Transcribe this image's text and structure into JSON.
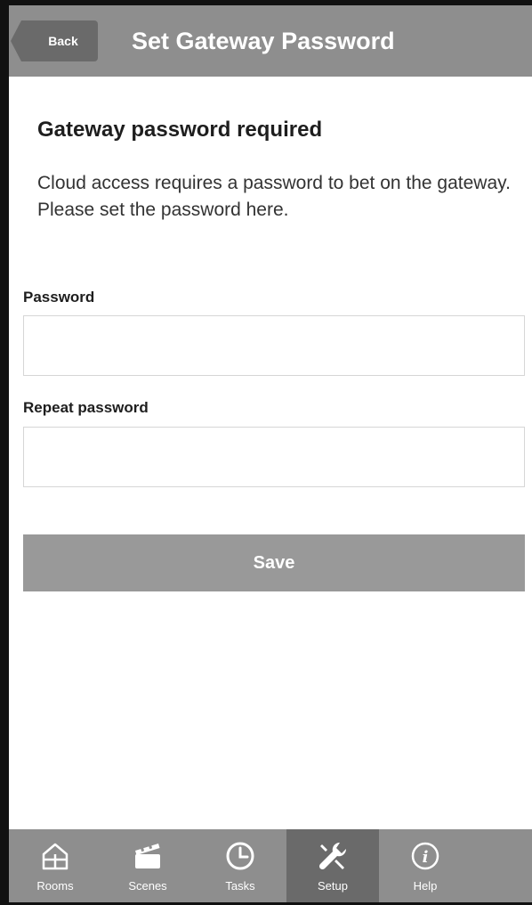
{
  "header": {
    "back_label": "Back",
    "title": "Set Gateway Password"
  },
  "main": {
    "section_title": "Gateway password required",
    "description": "Cloud access requires a password to bet on the gateway. Please set the password here.",
    "password_label": "Password",
    "password_value": "",
    "repeat_label": "Repeat password",
    "repeat_value": "",
    "save_label": "Save"
  },
  "tabs": [
    {
      "label": "Rooms",
      "icon": "house-icon"
    },
    {
      "label": "Scenes",
      "icon": "clapperboard-icon"
    },
    {
      "label": "Tasks",
      "icon": "clock-icon"
    },
    {
      "label": "Setup",
      "icon": "tools-icon",
      "active": true
    },
    {
      "label": "Help",
      "icon": "info-icon"
    }
  ],
  "colors": {
    "bar": "#8e8e8e",
    "bar_active": "#6a6a6a",
    "button": "#999999"
  }
}
